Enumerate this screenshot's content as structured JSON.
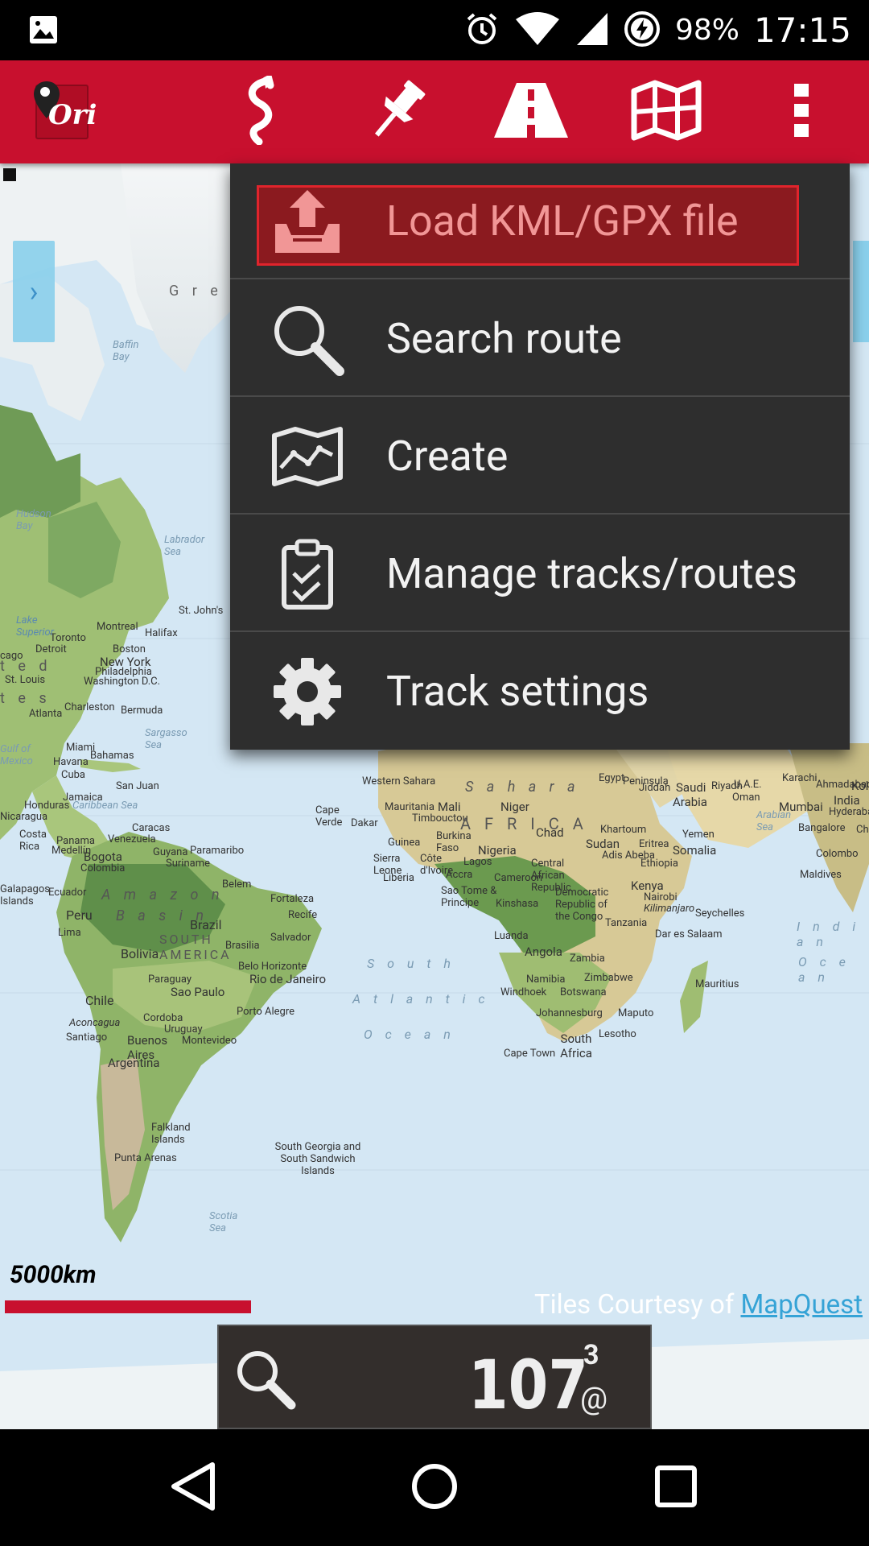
{
  "status_bar": {
    "battery": "98%",
    "time": "17:15"
  },
  "toolbar": {
    "app_logo_text": "Ori"
  },
  "map": {
    "labels": {
      "greenland": "G r e",
      "baffin": "Baffin Bay",
      "hudson": "Hudson Bay",
      "labrador": "Labrador Sea",
      "montreal": "Montreal",
      "halifax": "Halifax",
      "st_johns": "St. John's",
      "toronto": "Toronto",
      "detroit": "Detroit",
      "boston": "Boston",
      "new_york": "New York",
      "philadelphia": "Philadelphia",
      "washington": "Washington D.C.",
      "chicago": "cago",
      "st_louis": "St. Louis",
      "atlanta": "Atlanta",
      "charleston": "Charleston",
      "bermuda": "Bermuda",
      "sargasso": "Sargasso Sea",
      "gulf": "Gulf of Mexico",
      "miami": "Miami",
      "bahamas": "Bahamas",
      "havana": "Havana",
      "cuba": "Cuba",
      "jamaica": "Jamaica",
      "san_juan": "San Juan",
      "honduras": "Honduras",
      "caribbean": "Caribbean Sea",
      "nicaragua": "Nicaragua",
      "costa_rica": "Costa Rica",
      "panama": "Panama",
      "medellin": "Medellín",
      "caracas": "Caracas",
      "venezuela": "Venezuela",
      "bogota": "Bogota",
      "colombia": "Colombia",
      "guyana": "Guyana",
      "paramaribo": "Paramaribo",
      "suriname": "Suriname",
      "ecuador": "Ecuador",
      "peru": "Peru",
      "lima": "Lima",
      "amazon": "A m a z o n",
      "basin": "B a s i n",
      "belem": "Belem",
      "fortaleza": "Fortaleza",
      "recife": "Recife",
      "brazil": "Brazil",
      "salvador": "Salvador",
      "brasilia": "Brasilia",
      "bolivia": "Bolivia",
      "south_america": "SOUTH AMERICA",
      "belo_horizonte": "Belo Horizonte",
      "rio": "Rio de Janeiro",
      "paraguay": "Paraguay",
      "sao_paulo": "Sao Paulo",
      "chile": "Chile",
      "porto_alegre": "Porto Alegre",
      "aconcagua": "Aconcagua",
      "cordoba": "Cordoba",
      "uruguay": "Uruguay",
      "santiago": "Santiago",
      "buenos_aires": "Buenos Aires",
      "montevideo": "Montevideo",
      "argentina": "Argentina",
      "falkland": "Falkland Islands",
      "punta_arenas": "Punta Arenas",
      "south_georgia": "South Georgia and South Sandwich Islands",
      "scotia": "Scotia Sea",
      "galapagos": "Galapagos Islands",
      "south_atlantic_1": "S o u t h",
      "south_atlantic_2": "A t l a n t i c",
      "south_atlantic_3": "O c e a n",
      "sahara": "S a h a r a",
      "africa": "A F R I C A",
      "western_sahara": "Western Sahara",
      "mauritania": "Mauritania",
      "mali": "Mali",
      "niger": "Niger",
      "chad": "Chad",
      "timbouctou": "Timbouctou",
      "cape_verde": "Cape Verde",
      "dakar": "Dakar",
      "guinea": "Guinea",
      "burkina": "Burkina Faso",
      "sierra_leone": "Sierra Leone",
      "cote_divoire": "Côte d'Ivoire",
      "liberia": "Liberia",
      "accra": "Accra",
      "nigeria": "Nigeria",
      "lagos": "Lagos",
      "cameroon": "Cameroon",
      "sao_tome": "Sao Tome & Principe",
      "car": "Central African Republic",
      "sudan": "Sudan",
      "khartoum": "Khartoum",
      "eritrea": "Eritrea",
      "yemen": "Yemen",
      "ethiopia": "Ethiopia",
      "addis": "Adis Abeba",
      "somalia": "Somalia",
      "kinshasa": "Kinshasa",
      "drc": "Democratic Republic of the Congo",
      "kenya": "Kenya",
      "nairobi": "Nairobi",
      "kilimanjaro": "Kilimanjaro",
      "tanzania": "Tanzania",
      "dar": "Dar es Salaam",
      "seychelles": "Seychelles",
      "luanda": "Luanda",
      "angola": "Angola",
      "zambia": "Zambia",
      "zimbabwe": "Zimbabwe",
      "namibia": "Namibia",
      "windhoek": "Windhoek",
      "botswana": "Botswana",
      "johannesburg": "Johannesburg",
      "maputo": "Maputo",
      "lesotho": "Lesotho",
      "south_africa": "South Africa",
      "cape_town": "Cape Town",
      "mauritius": "Mauritius",
      "arabia": "Arabia",
      "saudi": "Saudi",
      "jiddah": "Jiddah",
      "peninsula": "Peninsula",
      "riyadh": "Riyadh",
      "uae": "U.A.E.",
      "oman": "Oman",
      "karachi": "Karachi",
      "ahmadabad": "Ahmadabad",
      "mumbai": "Mumbai",
      "india": "India",
      "hyderabad": "Hyderabad",
      "arabian_sea": "Arabian Sea",
      "bangalore": "Bangalore",
      "colombo": "Colombo",
      "maldives": "Maldives",
      "indian_ocean_1": "I n d i a n",
      "indian_ocean_2": "O c e a n",
      "egypt": "Egypt",
      "st_lawrence": "Lake Superior",
      "united_states": "t e d",
      "states": "t e s",
      "kolkata": "Kol",
      "che": "Che"
    },
    "scale": "5000km",
    "attribution_prefix": "Tiles Courtesy of",
    "attribution_link": "MapQuest"
  },
  "menu": {
    "items": [
      {
        "label": "Load KML/GPX file",
        "icon": "upload-tray-icon",
        "highlighted": true
      },
      {
        "label": "Search route",
        "icon": "magnifier-icon"
      },
      {
        "label": "Create",
        "icon": "route-map-icon"
      },
      {
        "label": "Manage tracks/routes",
        "icon": "clipboard-check-icon"
      },
      {
        "label": "Track settings",
        "icon": "gear-icon"
      }
    ]
  },
  "bottom_panel": {
    "count": "107",
    "superscript": "3",
    "at_symbol": "@"
  },
  "colors": {
    "toolbar": "#c8102e",
    "menu_bg": "#2e2e2e",
    "highlight_bg": "#8b1a1f",
    "highlight_border": "#e0242c",
    "scale_bar": "#c8102e",
    "attribution_link": "#35a3d6"
  }
}
